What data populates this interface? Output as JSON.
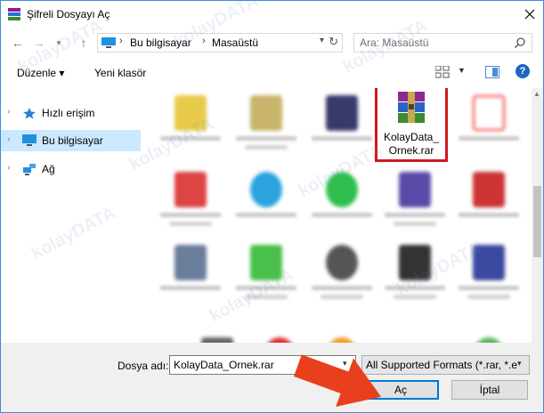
{
  "window": {
    "title": "Şifreli Dosyayı Aç"
  },
  "address": {
    "crumbs": [
      "Bu bilgisayar",
      "Masaüstü"
    ]
  },
  "search": {
    "placeholder": "Ara: Masaüstü"
  },
  "commands": {
    "organize": "Düzenle ▾",
    "new_folder": "Yeni klasör"
  },
  "navigation": {
    "items": [
      {
        "label": "Hızlı erişim",
        "icon": "star-icon",
        "selected": false
      },
      {
        "label": "Bu bilgisayar",
        "icon": "computer-icon",
        "selected": true
      },
      {
        "label": "Ağ",
        "icon": "network-icon",
        "selected": false
      }
    ]
  },
  "files": {
    "highlighted": {
      "name_line1": "KolayData_",
      "name_line2": "Ornek.rar",
      "icon": "winrar-archive-icon"
    }
  },
  "footer": {
    "filename_label": "Dosya adı:",
    "filename_value": "KolayData_Ornek.rar",
    "filetype": "All Supported Formats (*.rar, *.e",
    "open_label": "Aç",
    "cancel_label": "İptal"
  },
  "watermark": {
    "text_a": "kolay",
    "text_b": "DATA"
  },
  "colors": {
    "accent": "#0078d7",
    "highlight_border": "#d0181e",
    "selection": "#cce8ff",
    "arrow": "#e8401c"
  }
}
